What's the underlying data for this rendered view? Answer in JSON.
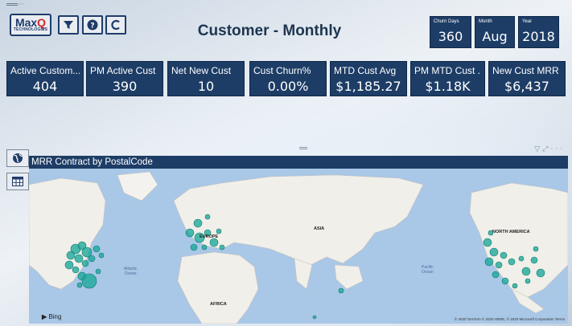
{
  "logo": {
    "brand_prefix": "Max",
    "brand_suffix": "Q",
    "brand_sub": "TECHNOLOGIES"
  },
  "toolbar": [
    {
      "name": "filter-icon"
    },
    {
      "name": "help-icon"
    },
    {
      "name": "refresh-icon"
    }
  ],
  "title": "Customer - Monthly",
  "slicers": [
    {
      "label": "Churn Days",
      "value": "360"
    },
    {
      "label": "Month",
      "value": "Aug"
    },
    {
      "label": "Year",
      "value": "2018"
    }
  ],
  "cards": [
    {
      "label": "Active Custom...",
      "value": "404"
    },
    {
      "label": "PM Active Cust",
      "value": "390"
    },
    {
      "label": "Net New Cust",
      "value": "10"
    },
    {
      "label": "Cust Churn%",
      "value": "0.00%"
    },
    {
      "label": "MTD Cust Avg",
      "value": "$1,185.27"
    },
    {
      "label": "PM MTD Cust ...",
      "value": "$1.18K"
    },
    {
      "label": "New Cust MRR",
      "value": "$6,437"
    }
  ],
  "side_buttons": [
    {
      "name": "globe-icon"
    },
    {
      "name": "table-icon"
    }
  ],
  "map": {
    "title": "MRR Contract by PostalCode",
    "labels": {
      "europe": "EUROPE",
      "asia": "ASIA",
      "africa": "AFRICA",
      "north_america": "NORTH AMERICA",
      "atlantic": "Atlantic\nOcean",
      "pacific": "Pacific\nOcean"
    },
    "bing": "Bing",
    "copyright": "© 2020 TomTom © 2020 HERE, © 2020 Microsoft Corporation  Terms",
    "bubble_color": "#1aa89a"
  }
}
